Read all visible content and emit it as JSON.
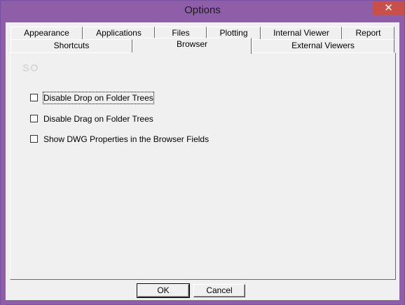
{
  "window": {
    "title": "Options",
    "close_glyph": "✕"
  },
  "tabs": {
    "row1": [
      "Appearance",
      "Applications",
      "Files",
      "Plotting",
      "Internal Viewer",
      "Report"
    ],
    "row2": [
      "Shortcuts",
      "Browser",
      "External Viewers"
    ],
    "active": "Browser"
  },
  "browser": {
    "options": [
      {
        "label": "Disable Drop on Folder Trees",
        "checked": false
      },
      {
        "label": "Disable Drag on Folder Trees",
        "checked": false
      },
      {
        "label": "Show DWG Properties in the Browser Fields",
        "checked": false
      }
    ]
  },
  "buttons": {
    "ok": "OK",
    "cancel": "Cancel"
  },
  "watermark": "SO"
}
